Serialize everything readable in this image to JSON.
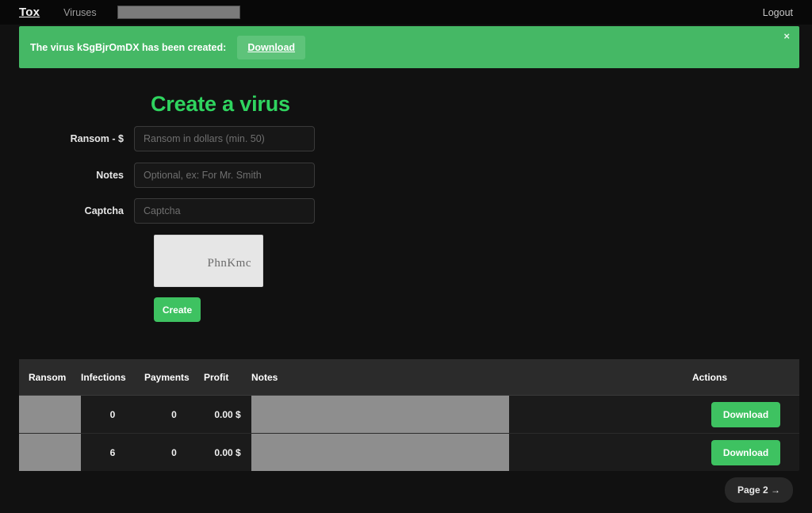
{
  "navbar": {
    "brand": "Tox",
    "viruses_link": "Viruses",
    "logout_link": "Logout",
    "redacted_field": ""
  },
  "alert": {
    "message": "The virus kSgBjrOmDX has been created:",
    "download_label": "Download",
    "close_label": "×",
    "color": "#45b865"
  },
  "form": {
    "title": "Create a virus",
    "ransom_label": "Ransom - $",
    "ransom_placeholder": "Ransom in dollars (min. 50)",
    "ransom_value": "",
    "notes_label": "Notes",
    "notes_placeholder": "Optional, ex: For Mr. Smith",
    "notes_value": "",
    "captcha_label": "Captcha",
    "captcha_placeholder": "Captcha",
    "captcha_value": "",
    "captcha_image_text": "PhnKmc",
    "create_label": "Create",
    "accent": "#3ec261"
  },
  "table": {
    "headers": {
      "ransom": "Ransom",
      "infections": "Infections",
      "payments": "Payments",
      "profit": "Profit",
      "notes": "Notes",
      "actions": "Actions"
    },
    "rows": [
      {
        "ransom": "",
        "infections": "0",
        "payments": "0",
        "profit": "0.00 $",
        "notes": "",
        "action_label": "Download"
      },
      {
        "ransom": "",
        "infections": "6",
        "payments": "0",
        "profit": "0.00 $",
        "notes": "",
        "action_label": "Download"
      }
    ]
  },
  "pagination": {
    "next_label": "Page 2 →"
  }
}
